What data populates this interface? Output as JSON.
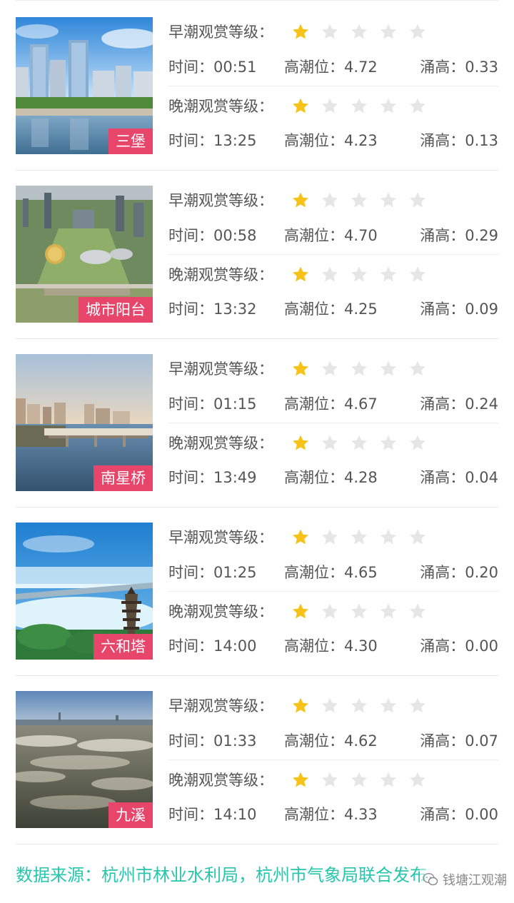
{
  "labels": {
    "morning_grade": "早潮观赏等级：",
    "evening_grade": "晚潮观赏等级：",
    "time": "时间：",
    "high_tide": "高潮位：",
    "surge": "涌高："
  },
  "rating_max": 5,
  "colors": {
    "star_filled": "#f7c31a",
    "star_empty": "#e6e6e6",
    "place_tag": "#e8456b",
    "footer_text": "#27c6ad"
  },
  "icons": {
    "star_filled": "star-filled-icon",
    "star_empty": "star-empty-icon",
    "watermark": "wechat-icon"
  },
  "locations": [
    {
      "name": "三堡",
      "morning": {
        "rating": 1,
        "time": "00:51",
        "high_tide": "4.72",
        "surge": "0.33"
      },
      "evening": {
        "rating": 1,
        "time": "13:25",
        "high_tide": "4.23",
        "surge": "0.13"
      }
    },
    {
      "name": "城市阳台",
      "morning": {
        "rating": 1,
        "time": "00:58",
        "high_tide": "4.70",
        "surge": "0.29"
      },
      "evening": {
        "rating": 1,
        "time": "13:32",
        "high_tide": "4.25",
        "surge": "0.09"
      }
    },
    {
      "name": "南星桥",
      "morning": {
        "rating": 1,
        "time": "01:15",
        "high_tide": "4.67",
        "surge": "0.24"
      },
      "evening": {
        "rating": 1,
        "time": "13:49",
        "high_tide": "4.28",
        "surge": "0.04"
      }
    },
    {
      "name": "六和塔",
      "morning": {
        "rating": 1,
        "time": "01:25",
        "high_tide": "4.65",
        "surge": "0.20"
      },
      "evening": {
        "rating": 1,
        "time": "14:00",
        "high_tide": "4.30",
        "surge": "0.00"
      }
    },
    {
      "name": "九溪",
      "morning": {
        "rating": 1,
        "time": "01:33",
        "high_tide": "4.62",
        "surge": "0.07"
      },
      "evening": {
        "rating": 1,
        "time": "14:10",
        "high_tide": "4.33",
        "surge": "0.00"
      }
    }
  ],
  "footer": {
    "source_text": "数据来源：杭州市林业水利局，杭州市气象局联合发布"
  },
  "watermark": {
    "text": "钱塘江观潮"
  }
}
